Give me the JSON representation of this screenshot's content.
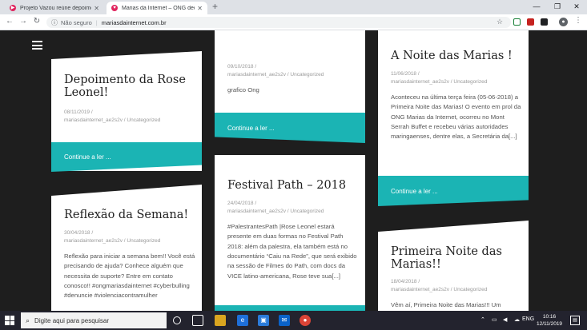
{
  "browser": {
    "tabs": [
      {
        "title": "Projeto Vazou reúne depoimentos",
        "active": false
      },
      {
        "title": "Marias da Internet – ONG dedica",
        "active": true
      }
    ],
    "security_label": "Não seguro",
    "url": "mariasdainternet.com.br"
  },
  "posts": [
    {
      "title": "Depoimento da Rose Leonel!",
      "date": "08/11/2019",
      "author": "mariasdainternet_ae2s2v",
      "category": "Uncategorized",
      "excerpt": "",
      "link": "Continue a ler ..."
    },
    {
      "title": "",
      "date": "09/10/2018",
      "author": "mariasdainternet_ae2s2v",
      "category": "Uncategorized",
      "excerpt": "grafico Ong",
      "link": "Continue a ler ..."
    },
    {
      "title": "A Noite das Marias !",
      "date": "11/06/2018",
      "author": "mariasdainternet_ae2s2v",
      "category": "Uncategorized",
      "excerpt": "Aconteceu na última terça feira (05-06-2018) a Primeira Noite das Marias! O evento em prol da ONG Marias da Internet, ocorreu no Mont Serrah Buffet e recebeu várias autoridades maringaenses, dentre elas, a Secretária da[...]",
      "link": "Continue a ler ..."
    },
    {
      "title": "Reflexão da Semana!",
      "date": "30/04/2018",
      "author": "mariasdainternet_ae2s2v",
      "category": "Uncategorized",
      "excerpt": "Reflexão para iniciar a semana bem!! Você está precisando de ajuda? Conhece alguém que necessita de suporte? Entre em contato conosco!! #ongmariasdainternet #cyberbulling #denuncie #violenciacontramulher",
      "link": ""
    },
    {
      "title": "Festival Path – 2018",
      "date": "24/04/2018",
      "author": "mariasdainternet_ae2s2v",
      "category": "Uncategorized",
      "excerpt": "#PalestrantesPath |Rose Leonel estará presente em duas formas no Festival Path 2018: além da palestra, ela também está no documentário “Caiu na Rede”, que será exibido na sessão de Filmes do Path, com docs da VICE latino-americana, Rose teve sua[...]",
      "link": ""
    },
    {
      "title": "Primeira Noite das Marias!!",
      "date": "18/04/2018",
      "author": "mariasdainternet_ae2s2v",
      "category": "Uncategorized",
      "excerpt": "Vêm aí, Primeira Noite das Marias!!! Um",
      "link": ""
    }
  ],
  "taskbar": {
    "search_placeholder": "Digite aqui para pesquisar",
    "language": "ENG",
    "time": "10:16",
    "date": "12/11/2019"
  },
  "colors": {
    "accent": "#1bb4b4",
    "background": "#1e1e1e"
  }
}
